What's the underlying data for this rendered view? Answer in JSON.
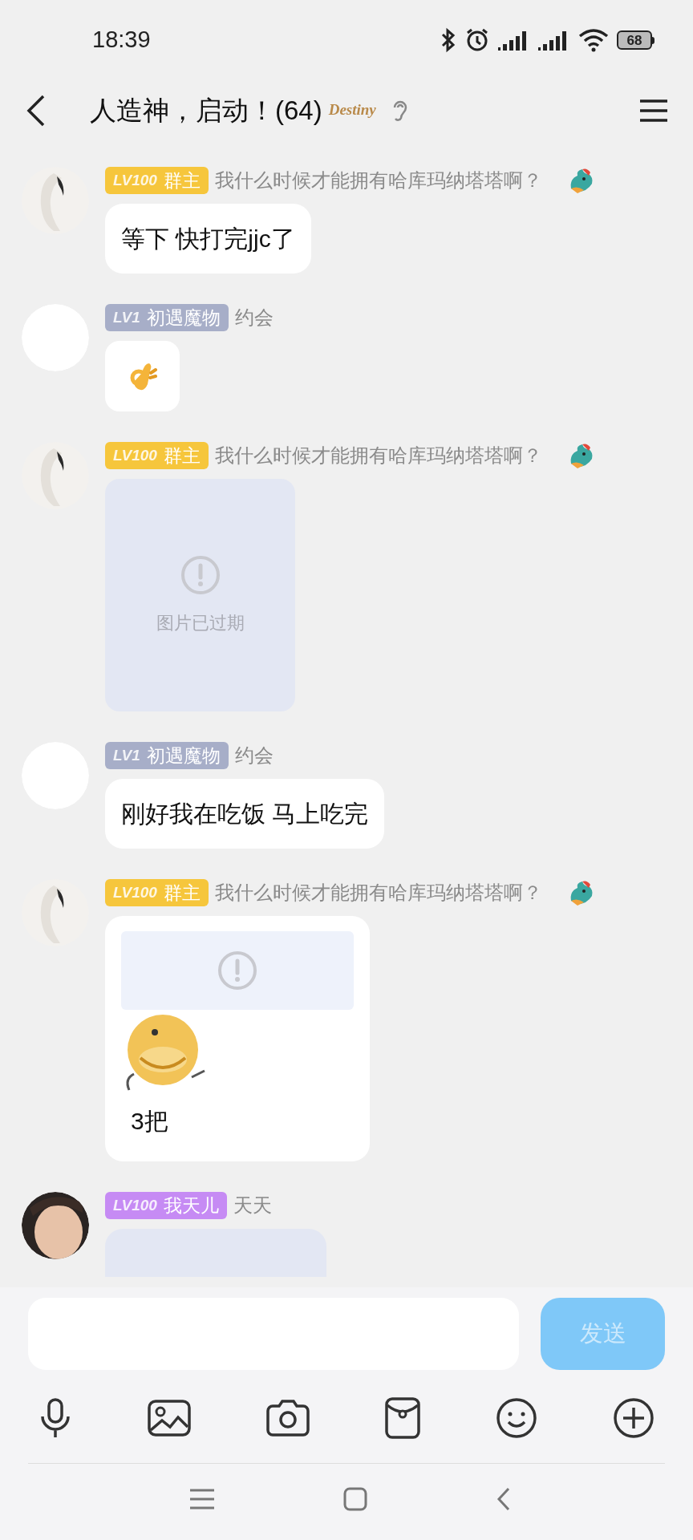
{
  "status_bar": {
    "time": "18:39",
    "battery": "68"
  },
  "header": {
    "title": "人造神，启动！(64)",
    "logo": "Destiny"
  },
  "messages": [
    {
      "avatar": {
        "kind": "figure"
      },
      "level": "LV100",
      "role": "群主",
      "color": "#f6c63c",
      "name": "我什么时候才能拥有哈库玛纳塔塔啊？",
      "dragon_badge": true,
      "content": {
        "kind": "text",
        "text": "等下 快打完jjc了"
      }
    },
    {
      "avatar": {
        "kind": "blank"
      },
      "level": "LV1",
      "role": "初遇魔物",
      "color": "#a7aec8",
      "name": "约会",
      "dragon_badge": false,
      "content": {
        "kind": "emoji"
      }
    },
    {
      "avatar": {
        "kind": "figure"
      },
      "level": "LV100",
      "role": "群主",
      "color": "#f6c63c",
      "name": "我什么时候才能拥有哈库玛纳塔塔啊？",
      "dragon_badge": true,
      "content": {
        "kind": "expired_image",
        "caption": "图片已过期"
      }
    },
    {
      "avatar": {
        "kind": "blank"
      },
      "level": "LV1",
      "role": "初遇魔物",
      "color": "#a7aec8",
      "name": "约会",
      "dragon_badge": false,
      "content": {
        "kind": "text",
        "text": "刚好我在吃饭 马上吃完"
      }
    },
    {
      "avatar": {
        "kind": "figure"
      },
      "level": "LV100",
      "role": "群主",
      "color": "#f6c63c",
      "name": "我什么时候才能拥有哈库玛纳塔塔啊？",
      "dragon_badge": true,
      "content": {
        "kind": "reply_sticker",
        "text": "3把"
      }
    },
    {
      "avatar": {
        "kind": "photo"
      },
      "level": "LV100",
      "role": "我天儿",
      "color": "#c68bf4",
      "name": "天天",
      "dragon_badge": false,
      "content": {
        "kind": "cut"
      }
    }
  ],
  "composer": {
    "send_label": "发送",
    "disabled": true
  }
}
